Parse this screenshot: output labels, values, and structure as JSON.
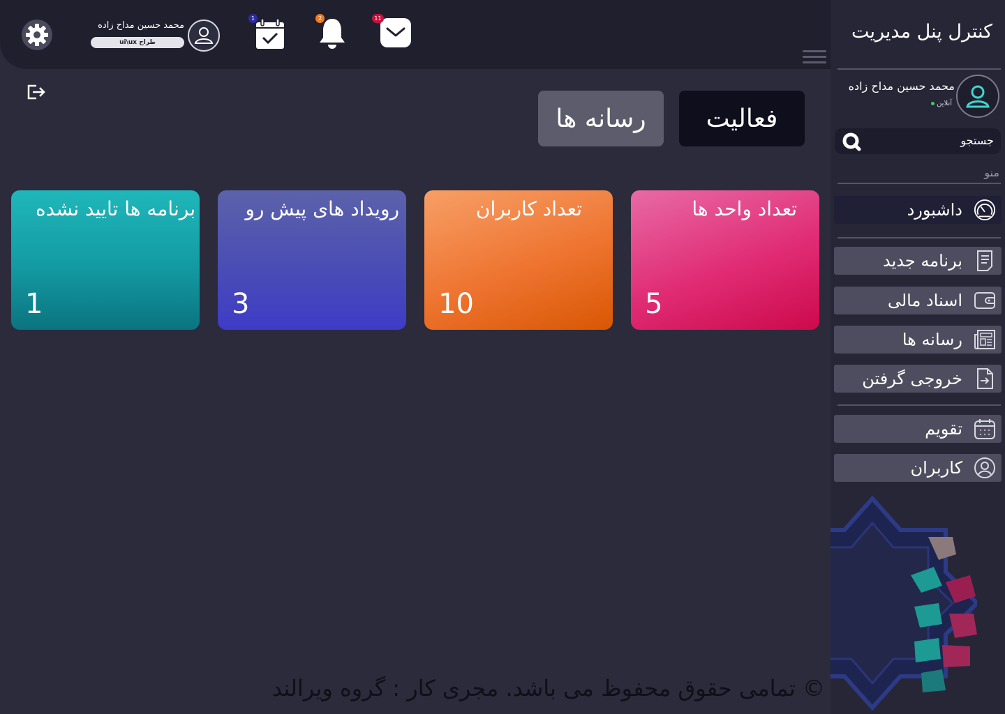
{
  "sidebar": {
    "brand": "کنترل پنل مدیریت",
    "user": {
      "name": "محمد حسین مداح زاده",
      "status": "آنلاین"
    },
    "search": {
      "label": "جستجو"
    },
    "menu_caption": "منو",
    "items": [
      {
        "label": "داشبورد",
        "icon": "dashboard-gauge-icon"
      },
      {
        "label": "برنامه جدید",
        "icon": "document-icon"
      },
      {
        "label": "اسناد مالی",
        "icon": "wallet-icon"
      },
      {
        "label": "رسانه ها",
        "icon": "newspaper-icon"
      },
      {
        "label": "خروجی گرفتن",
        "icon": "file-export-icon"
      },
      {
        "label": "تقویم",
        "icon": "calendar-icon"
      },
      {
        "label": "کاربران",
        "icon": "user-circle-icon"
      }
    ]
  },
  "topbar": {
    "user_name": "محمد حسین مداح زاده",
    "user_role": "طراح ui\\ux",
    "badges": {
      "calendar": "1",
      "notifications": "2",
      "messages": "11"
    },
    "colors": {
      "calendar_badge": "#2b2ba8",
      "notifications_badge": "#f07a1f",
      "messages_badge": "#c8103f"
    }
  },
  "tabs": {
    "activity": "فعالیت",
    "media": "رسانه ها"
  },
  "cards": [
    {
      "title": "تعداد واحد ها",
      "value": "5",
      "color": "#e0296f"
    },
    {
      "title": "تعداد کاربران",
      "value": "10",
      "color": "#ef7428"
    },
    {
      "title": "رویداد های پیش رو",
      "value": "3",
      "color": "#4a4db4"
    },
    {
      "title": "برنامه ها تایید نشده",
      "value": "1",
      "color": "#139aa2"
    }
  ],
  "footer": "© تمامی حقوق محفوظ می باشد. مجری کار : گروه ویرالند"
}
